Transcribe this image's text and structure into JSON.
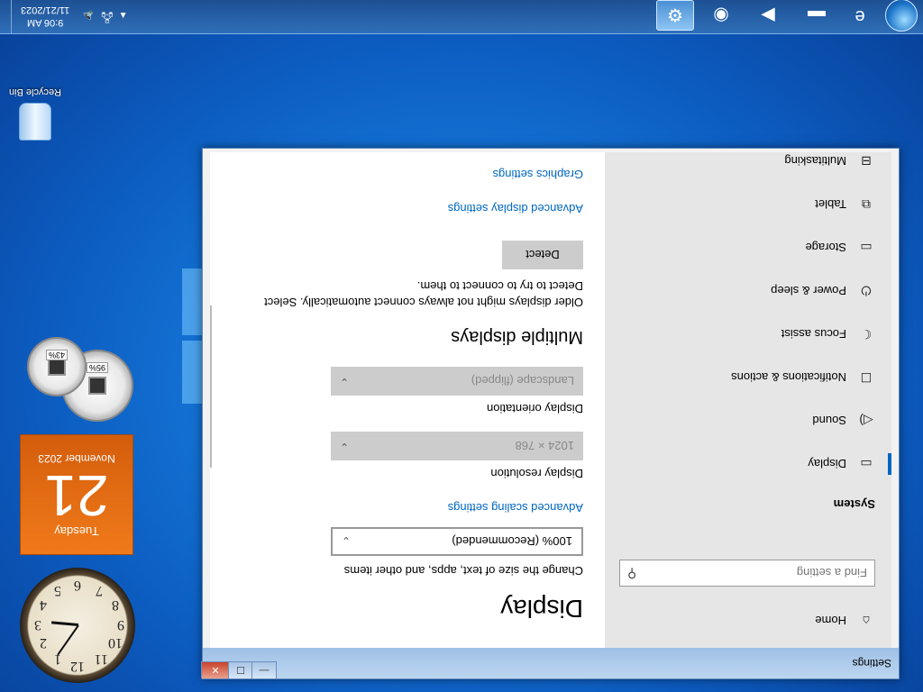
{
  "taskbar": {
    "clock_time": "9:06 AM",
    "clock_date": "11/21/2023",
    "pinned": [
      {
        "name": "internet-explorer-icon",
        "glyph": "e"
      },
      {
        "name": "file-explorer-icon",
        "glyph": "▬"
      },
      {
        "name": "media-player-icon",
        "glyph": "▶"
      },
      {
        "name": "chrome-icon",
        "glyph": "◉"
      },
      {
        "name": "settings-icon",
        "glyph": "⚙"
      }
    ]
  },
  "desktop": {
    "recycle_bin_label": "Recycle Bin"
  },
  "gadgets": {
    "calendar": {
      "day_name": "Tuesday",
      "day": "21",
      "month": "November 2023"
    },
    "meter": {
      "cpu": "43%",
      "memory": "95%"
    },
    "clock": {
      "numbers": [
        "12",
        "1",
        "2",
        "3",
        "4",
        "5",
        "6",
        "7",
        "8",
        "9",
        "10",
        "11"
      ]
    }
  },
  "window": {
    "title": "Settings",
    "nav": {
      "home": "Home",
      "search_placeholder": "Find a setting",
      "group": "System",
      "items": [
        {
          "label": "Display",
          "icon": "display-icon",
          "glyph": "▭",
          "selected": true
        },
        {
          "label": "Sound",
          "icon": "sound-icon",
          "glyph": "◁)"
        },
        {
          "label": "Notifications & actions",
          "icon": "notifications-icon",
          "glyph": "☐"
        },
        {
          "label": "Focus assist",
          "icon": "focus-assist-icon",
          "glyph": "☾"
        },
        {
          "label": "Power & sleep",
          "icon": "power-icon",
          "glyph": "⏻"
        },
        {
          "label": "Storage",
          "icon": "storage-icon",
          "glyph": "▭"
        },
        {
          "label": "Tablet",
          "icon": "tablet-icon",
          "glyph": "⧉"
        },
        {
          "label": "Multitasking",
          "icon": "multitasking-icon",
          "glyph": "⊟"
        }
      ]
    },
    "content": {
      "title": "Display",
      "scale_desc": "Change the size of text, apps, and other items",
      "scale_value": "100% (Recommended)",
      "advanced_scaling": "Advanced scaling settings",
      "resolution_label": "Display resolution",
      "resolution_value": "1024 × 768",
      "orientation_label": "Display orientation",
      "orientation_value": "Landscape (flipped)",
      "multiple_heading": "Multiple displays",
      "multiple_desc_1": "Older displays might not always connect automatically. Select",
      "multiple_desc_2": "Detect to try to connect to them.",
      "detect_button": "Detect",
      "advanced_display": "Advanced display settings",
      "graphics": "Graphics settings"
    }
  }
}
